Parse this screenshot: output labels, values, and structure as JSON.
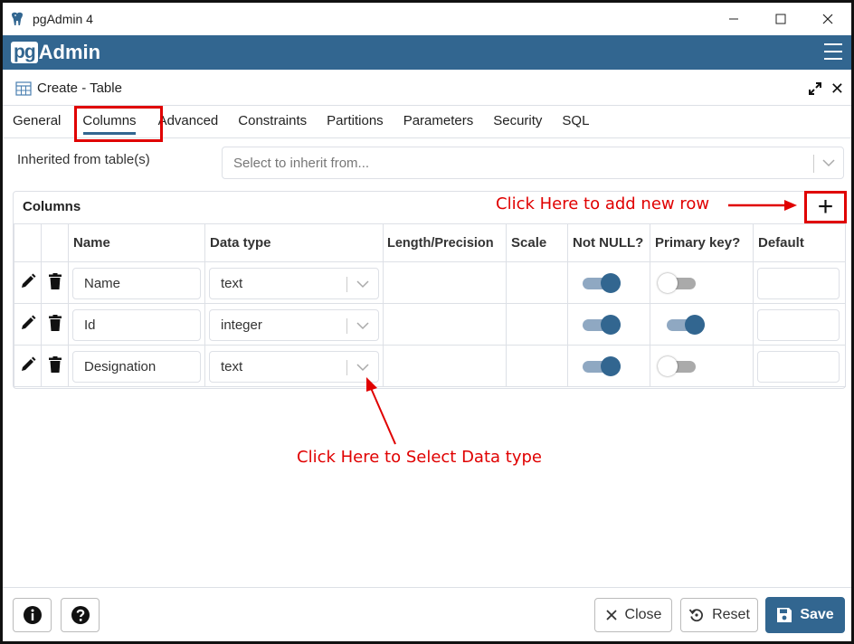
{
  "window": {
    "title": "pgAdmin 4",
    "minimize": "—",
    "maximize": "☐",
    "close": "✕"
  },
  "brand": {
    "pg": "pg",
    "admin": "Admin"
  },
  "dialog": {
    "title": "Create - Table",
    "close": "✕"
  },
  "tabs": [
    {
      "label": "General"
    },
    {
      "label": "Columns"
    },
    {
      "label": "Advanced"
    },
    {
      "label": "Constraints"
    },
    {
      "label": "Partitions"
    },
    {
      "label": "Parameters"
    },
    {
      "label": "Security"
    },
    {
      "label": "SQL"
    }
  ],
  "active_tab": "Columns",
  "inherit": {
    "label": "Inherited from table(s)",
    "placeholder": "Select to inherit from..."
  },
  "columns_panel": {
    "title": "Columns",
    "add_symbol": "+",
    "headers": [
      "Name",
      "Data type",
      "Length/Precision",
      "Scale",
      "Not NULL?",
      "Primary key?",
      "Default"
    ],
    "rows": [
      {
        "name": "Name",
        "data_type": "text",
        "not_null": true,
        "primary_key": false
      },
      {
        "name": "Id",
        "data_type": "integer",
        "not_null": true,
        "primary_key": true
      },
      {
        "name": "Designation",
        "data_type": "text",
        "not_null": true,
        "primary_key": false
      }
    ]
  },
  "annotations": {
    "add_row": "Click Here to add new row",
    "data_type": "Click Here to Select Data type"
  },
  "footer": {
    "close": "Close",
    "reset": "Reset",
    "save": "Save"
  },
  "colors": {
    "brand": "#326690",
    "annotation": "#e00000"
  }
}
